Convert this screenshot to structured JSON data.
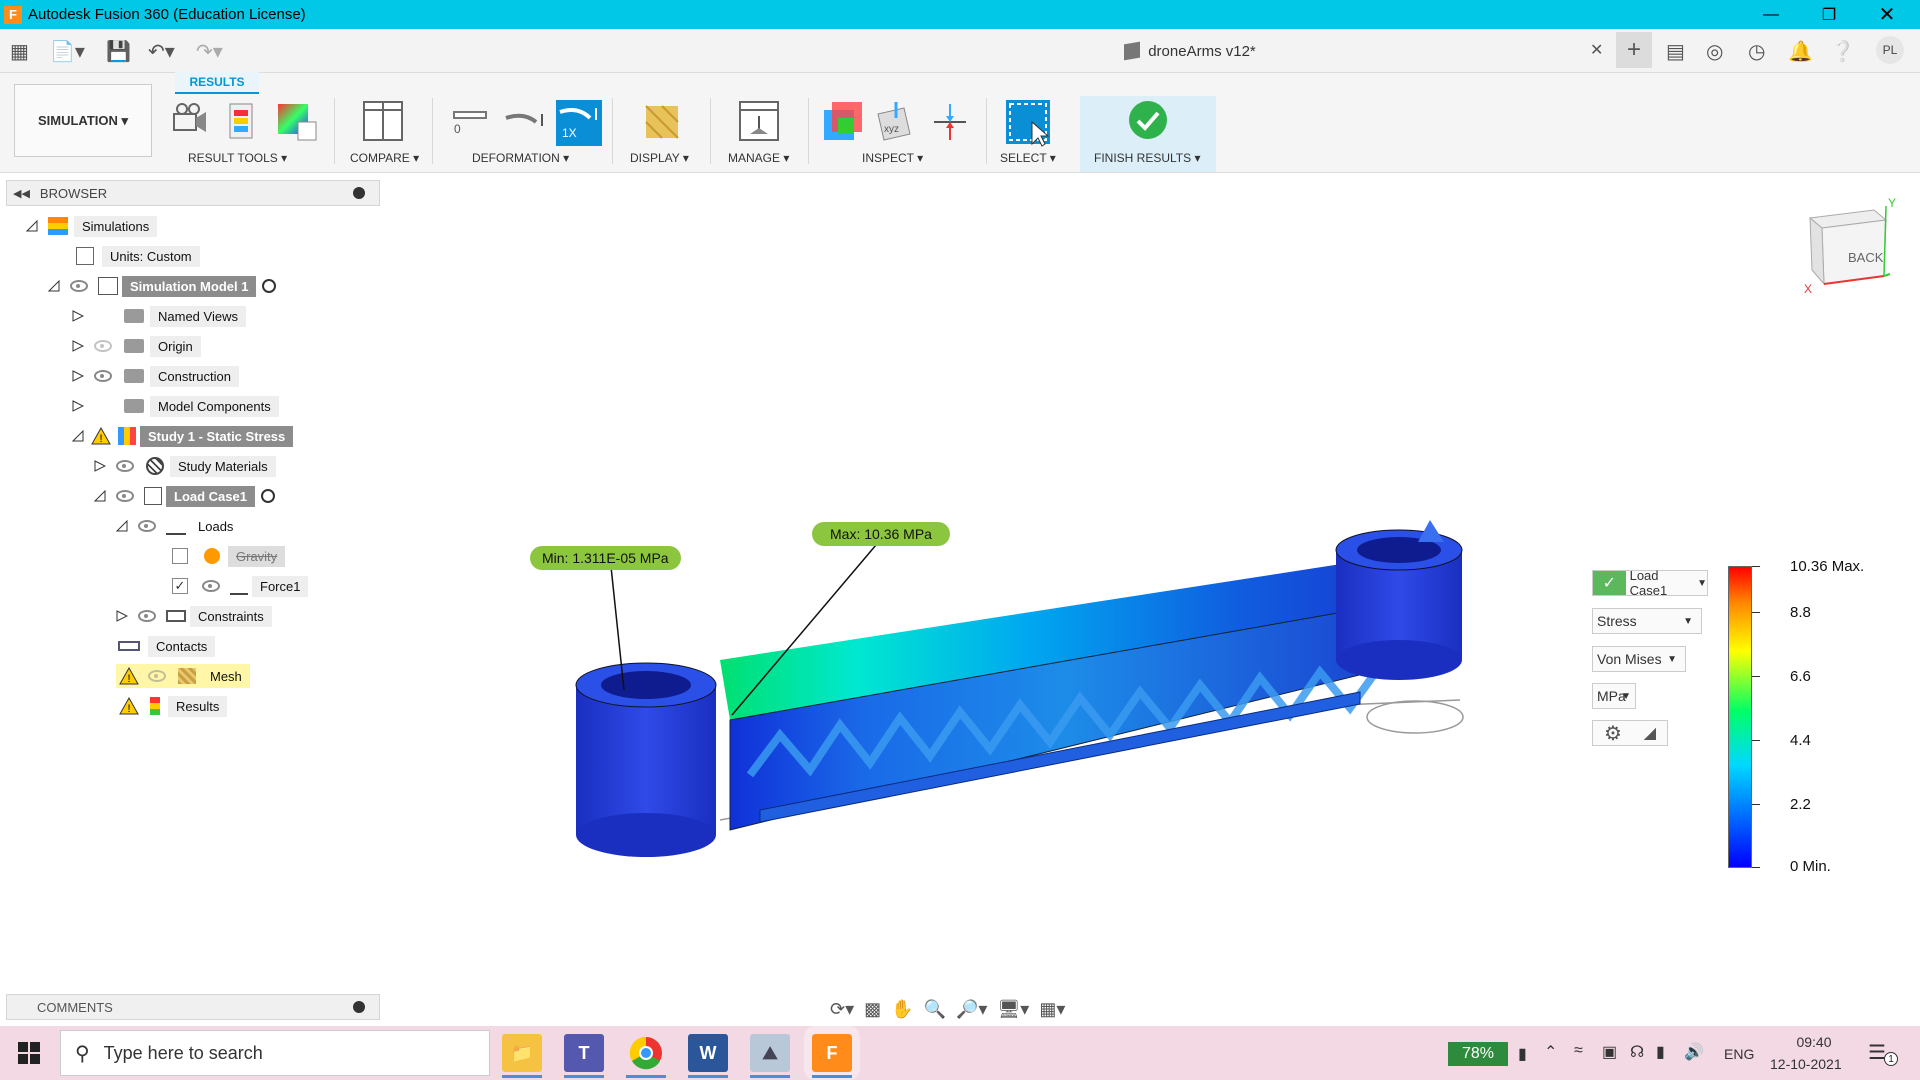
{
  "window": {
    "title": "Autodesk Fusion 360 (Education License)",
    "logo_letter": "F"
  },
  "document": {
    "tab_title": "droneArms v12*"
  },
  "user": {
    "initials": "PL"
  },
  "ribbon": {
    "workspace_label": "SIMULATION ▾",
    "active_tab": "RESULTS",
    "groups": {
      "result_tools": "RESULT TOOLS ▾",
      "compare": "COMPARE ▾",
      "deformation": "DEFORMATION ▾",
      "display": "DISPLAY ▾",
      "manage": "MANAGE ▾",
      "inspect": "INSPECT ▾",
      "select": "SELECT ▾",
      "finish": "FINISH RESULTS ▾"
    },
    "deformation_zero": "0",
    "deformation_scale": "1X"
  },
  "browser": {
    "title": "BROWSER",
    "items": [
      {
        "label": "Simulations"
      },
      {
        "label": "Units: Custom"
      },
      {
        "label": "Simulation Model 1"
      },
      {
        "label": "Named Views"
      },
      {
        "label": "Origin"
      },
      {
        "label": "Construction"
      },
      {
        "label": "Model Components"
      },
      {
        "label": "Study 1 - Static Stress"
      },
      {
        "label": "Study Materials"
      },
      {
        "label": "Load Case1"
      },
      {
        "label": "Loads"
      },
      {
        "label": "Gravity"
      },
      {
        "label": "Force1"
      },
      {
        "label": "Constraints"
      },
      {
        "label": "Contacts"
      },
      {
        "label": "Mesh"
      },
      {
        "label": "Results"
      }
    ]
  },
  "comments": {
    "title": "COMMENTS"
  },
  "viewcube": {
    "face_label": "BACK",
    "axis_x": "X",
    "axis_y": "Y"
  },
  "probes": {
    "min": "Min: 1.311E-05 MPa",
    "max": "Max: 10.36 MPa"
  },
  "legend": {
    "load_case": "Load Case1",
    "result_type": "Stress",
    "component": "Von Mises",
    "units": "MPa",
    "ticks": [
      "10.36 Max.",
      "8.8",
      "6.6",
      "4.4",
      "2.2",
      "0 Min."
    ],
    "colors": {
      "max": "#ff0000",
      "high": "#ffff00",
      "mid": "#00ff66",
      "low": "#00d8ff",
      "min": "#0000ff"
    }
  },
  "taskbar": {
    "search_placeholder": "Type here to search",
    "battery": "78%",
    "language": "ENG",
    "time": "09:40",
    "date": "12-10-2021",
    "notification_count": "1",
    "apps": [
      "file-explorer",
      "teams",
      "chrome",
      "word",
      "photos",
      "fusion360"
    ]
  }
}
